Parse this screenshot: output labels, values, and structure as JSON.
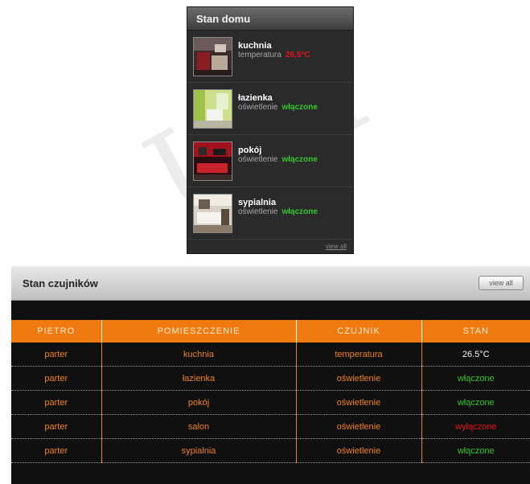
{
  "home_panel": {
    "title": "Stan domu",
    "rooms": [
      {
        "name": "kuchnia",
        "sensor": "temperatura",
        "state": "26,5°C",
        "state_color": "#e8111c",
        "image": "kitchen-photo"
      },
      {
        "name": "łazienka",
        "sensor": "oświetlenie",
        "state": "włączone",
        "state_color": "#35c62c",
        "image": "bathroom-photo"
      },
      {
        "name": "pokój",
        "sensor": "oświetlenie",
        "state": "włączone",
        "state_color": "#35c62c",
        "image": "living-room-photo"
      },
      {
        "name": "sypialnia",
        "sensor": "oświetlenie",
        "state": "włączone",
        "state_color": "#35c62c",
        "image": "bedroom-photo"
      }
    ],
    "view_all": "view all"
  },
  "sensor_panel": {
    "title": "Stan czujników",
    "view_all": "view all",
    "columns": [
      "PIETRO",
      "POMIESZCZENIE",
      "CZUJNIK",
      "STAN"
    ],
    "rows": [
      {
        "floor": "parter",
        "room": "kuchnia",
        "sensor": "temperatura",
        "state": "26.5°C"
      },
      {
        "floor": "parter",
        "room": "łazienka",
        "sensor": "oświetlenie",
        "state": "włączone"
      },
      {
        "floor": "parter",
        "room": "pokój",
        "sensor": "oświetlenie",
        "state": "włączone"
      },
      {
        "floor": "parter",
        "room": "salon",
        "sensor": "oświetlenie",
        "state": "wyłączone"
      },
      {
        "floor": "parter",
        "room": "sypialnia",
        "sensor": "oświetlenie",
        "state": "włączone"
      }
    ]
  },
  "colors": {
    "accent_orange": "#ef7b10",
    "state_on": "#35c62c",
    "state_off": "#e8111c",
    "panel_dark": "#2a2a2a"
  },
  "watermark": "UM"
}
